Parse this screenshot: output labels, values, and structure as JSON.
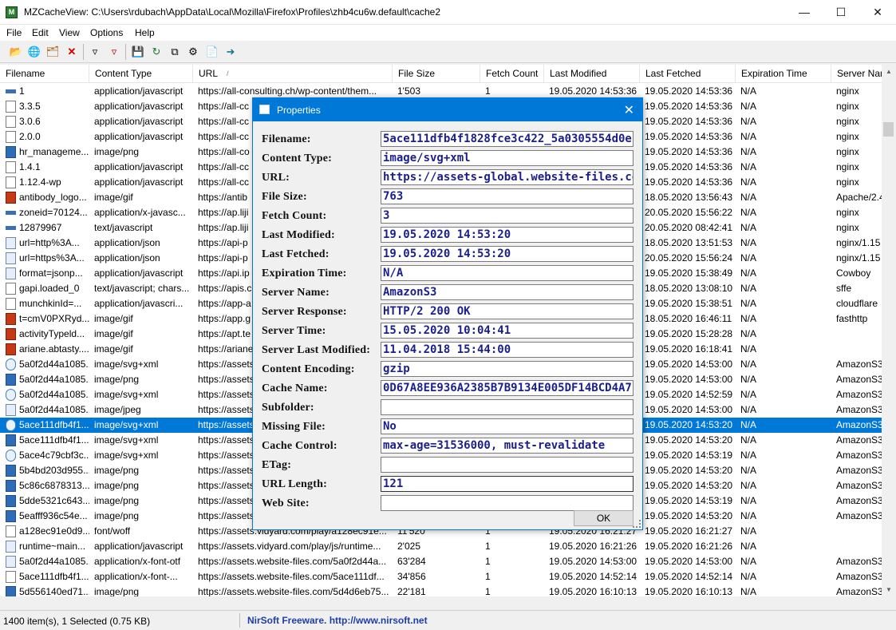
{
  "window": {
    "title": "MZCacheView:  C:\\Users\\rdubach\\AppData\\Local\\Mozilla\\Firefox\\Profiles\\zhb4cu6w.default\\cache2",
    "icon": "mz"
  },
  "menu": [
    "File",
    "Edit",
    "View",
    "Options",
    "Help"
  ],
  "columns": [
    "Filename",
    "Content Type",
    "URL",
    "File Size",
    "Fetch Count",
    "Last Modified",
    "Last Fetched",
    "Expiration Time",
    "Server Nam"
  ],
  "url_sort_marker": "/",
  "rows": [
    {
      "icon": "dash",
      "f": "1",
      "t": "application/javascript",
      "u": "https://all-consulting.ch/wp-content/them...",
      "s": "1'503",
      "c": "1",
      "m": "19.05.2020 14:53:36",
      "l": "19.05.2020 14:53:36",
      "e": "N/A",
      "n": "nginx"
    },
    {
      "icon": "js",
      "f": "3.3.5",
      "t": "application/javascript",
      "u": "https://all-cc",
      "s": "",
      "c": "",
      "m": "",
      "l": "19.05.2020 14:53:36",
      "e": "N/A",
      "n": "nginx"
    },
    {
      "icon": "js",
      "f": "3.0.6",
      "t": "application/javascript",
      "u": "https://all-cc",
      "s": "",
      "c": "",
      "m": "",
      "l": "19.05.2020 14:53:36",
      "e": "N/A",
      "n": "nginx"
    },
    {
      "icon": "js",
      "f": "2.0.0",
      "t": "application/javascript",
      "u": "https://all-cc",
      "s": "",
      "c": "",
      "m": "",
      "l": "19.05.2020 14:53:36",
      "e": "N/A",
      "n": "nginx"
    },
    {
      "icon": "blue",
      "f": "hr_manageme...",
      "t": "image/png",
      "u": "https://all-co",
      "s": "",
      "c": "",
      "m": "",
      "l": "19.05.2020 14:53:36",
      "e": "N/A",
      "n": "nginx"
    },
    {
      "icon": "js",
      "f": "1.4.1",
      "t": "application/javascript",
      "u": "https://all-cc",
      "s": "",
      "c": "",
      "m": "",
      "l": "19.05.2020 14:53:36",
      "e": "N/A",
      "n": "nginx"
    },
    {
      "icon": "js",
      "f": "1.12.4-wp",
      "t": "application/javascript",
      "u": "https://all-cc",
      "s": "",
      "c": "",
      "m": "",
      "l": "19.05.2020 14:53:36",
      "e": "N/A",
      "n": "nginx"
    },
    {
      "icon": "gif",
      "f": "antibody_logo...",
      "t": "image/gif",
      "u": "https://antib",
      "s": "",
      "c": "",
      "m": "",
      "l": "18.05.2020 13:56:43",
      "e": "N/A",
      "n": "Apache/2.4"
    },
    {
      "icon": "dash",
      "f": "zoneid=70124...",
      "t": "application/x-javasc...",
      "u": "https://ap.liji",
      "s": "",
      "c": "",
      "m": "",
      "l": "20.05.2020 15:56:22",
      "e": "N/A",
      "n": "nginx"
    },
    {
      "icon": "dash",
      "f": "12879967",
      "t": "text/javascript",
      "u": "https://ap.liji",
      "s": "",
      "c": "",
      "m": "",
      "l": "20.05.2020 08:42:41",
      "e": "N/A",
      "n": "nginx"
    },
    {
      "icon": "img",
      "f": "url=http%3A...",
      "t": "application/json",
      "u": "https://api-p",
      "s": "",
      "c": "",
      "m": "",
      "l": "18.05.2020 13:51:53",
      "e": "N/A",
      "n": "nginx/1.15"
    },
    {
      "icon": "img",
      "f": "url=https%3A...",
      "t": "application/json",
      "u": "https://api-p",
      "s": "",
      "c": "",
      "m": "",
      "l": "20.05.2020 15:56:24",
      "e": "N/A",
      "n": "nginx/1.15"
    },
    {
      "icon": "img",
      "f": "format=jsonp...",
      "t": "application/javascript",
      "u": "https://api.ip",
      "s": "",
      "c": "",
      "m": "",
      "l": "19.05.2020 15:38:49",
      "e": "N/A",
      "n": "Cowboy"
    },
    {
      "icon": "js",
      "f": "gapi.loaded_0",
      "t": "text/javascript; chars...",
      "u": "https://apis.c",
      "s": "",
      "c": "",
      "m": "",
      "l": "18.05.2020 13:08:10",
      "e": "N/A",
      "n": "sffe"
    },
    {
      "icon": "js",
      "f": "munchkinId=...",
      "t": "application/javascri...",
      "u": "https://app-a",
      "s": "",
      "c": "",
      "m": "",
      "l": "19.05.2020 15:38:51",
      "e": "N/A",
      "n": "cloudflare"
    },
    {
      "icon": "gif",
      "f": "t=cmV0PXRyd...",
      "t": "image/gif",
      "u": "https://app.g",
      "s": "",
      "c": "",
      "m": "",
      "l": "18.05.2020 16:46:11",
      "e": "N/A",
      "n": "fasthttp"
    },
    {
      "icon": "gif",
      "f": "activityTypeld...",
      "t": "image/gif",
      "u": "https://apt.te",
      "s": "",
      "c": "",
      "m": "",
      "l": "19.05.2020 15:28:28",
      "e": "N/A",
      "n": ""
    },
    {
      "icon": "gif",
      "f": "ariane.abtasty....",
      "t": "image/gif",
      "u": "https://ariane",
      "s": "",
      "c": "",
      "m": "",
      "l": "19.05.2020 16:18:41",
      "e": "N/A",
      "n": ""
    },
    {
      "icon": "ie",
      "f": "5a0f2d44a1085...",
      "t": "image/svg+xml",
      "u": "https://assets",
      "s": "",
      "c": "",
      "m": "",
      "l": "19.05.2020 14:53:00",
      "e": "N/A",
      "n": "AmazonS3"
    },
    {
      "icon": "blue",
      "f": "5a0f2d44a1085...",
      "t": "image/png",
      "u": "https://assets",
      "s": "",
      "c": "",
      "m": "",
      "l": "19.05.2020 14:53:00",
      "e": "N/A",
      "n": "AmazonS3"
    },
    {
      "icon": "ie",
      "f": "5a0f2d44a1085...",
      "t": "image/svg+xml",
      "u": "https://assets",
      "s": "",
      "c": "",
      "m": "",
      "l": "19.05.2020 14:52:59",
      "e": "N/A",
      "n": "AmazonS3"
    },
    {
      "icon": "img",
      "f": "5a0f2d44a1085...",
      "t": "image/jpeg",
      "u": "https://assets",
      "s": "",
      "c": "",
      "m": "",
      "l": "19.05.2020 14:53:00",
      "e": "N/A",
      "n": "AmazonS3"
    },
    {
      "icon": "ie",
      "f": "5ace111dfb4f1...",
      "t": "image/svg+xml",
      "u": "https://assets",
      "s": "",
      "c": "",
      "m": "",
      "l": "19.05.2020 14:53:20",
      "e": "N/A",
      "n": "AmazonS3",
      "sel": true
    },
    {
      "icon": "blue",
      "f": "5ace111dfb4f1...",
      "t": "image/svg+xml",
      "u": "https://assets",
      "s": "",
      "c": "",
      "m": "",
      "l": "19.05.2020 14:53:20",
      "e": "N/A",
      "n": "AmazonS3"
    },
    {
      "icon": "ie",
      "f": "5ace4c79cbf3c...",
      "t": "image/svg+xml",
      "u": "https://assets",
      "s": "",
      "c": "",
      "m": "",
      "l": "19.05.2020 14:53:19",
      "e": "N/A",
      "n": "AmazonS3"
    },
    {
      "icon": "blue",
      "f": "5b4bd203d955...",
      "t": "image/png",
      "u": "https://assets",
      "s": "",
      "c": "",
      "m": "",
      "l": "19.05.2020 14:53:20",
      "e": "N/A",
      "n": "AmazonS3"
    },
    {
      "icon": "blue",
      "f": "5c86c6878313...",
      "t": "image/png",
      "u": "https://assets",
      "s": "",
      "c": "",
      "m": "",
      "l": "19.05.2020 14:53:20",
      "e": "N/A",
      "n": "AmazonS3"
    },
    {
      "icon": "blue",
      "f": "5dde5321c643...",
      "t": "image/png",
      "u": "https://assets",
      "s": "",
      "c": "",
      "m": "",
      "l": "19.05.2020 14:53:19",
      "e": "N/A",
      "n": "AmazonS3"
    },
    {
      "icon": "blue",
      "f": "5eafff936c54e...",
      "t": "image/png",
      "u": "https://assets",
      "s": "",
      "c": "",
      "m": "",
      "l": "19.05.2020 14:53:20",
      "e": "N/A",
      "n": "AmazonS3"
    },
    {
      "icon": "js",
      "f": "a128ec91e0d9...",
      "t": "font/woff",
      "u": "https://assets.vidyard.com/play/a128ec91e...",
      "s": "11'520",
      "c": "1",
      "m": "19.05.2020 16:21:27",
      "l": "19.05.2020 16:21:27",
      "e": "N/A",
      "n": ""
    },
    {
      "icon": "img",
      "f": "runtime~main...",
      "t": "application/javascript",
      "u": "https://assets.vidyard.com/play/js/runtime...",
      "s": "2'025",
      "c": "1",
      "m": "19.05.2020 16:21:26",
      "l": "19.05.2020 16:21:26",
      "e": "N/A",
      "n": ""
    },
    {
      "icon": "img",
      "f": "5a0f2d44a1085...",
      "t": "application/x-font-otf",
      "u": "https://assets.website-files.com/5a0f2d44a...",
      "s": "63'284",
      "c": "1",
      "m": "19.05.2020 14:53:00",
      "l": "19.05.2020 14:53:00",
      "e": "N/A",
      "n": "AmazonS3"
    },
    {
      "icon": "js",
      "f": "5ace111dfb4f1...",
      "t": "application/x-font-...",
      "u": "https://assets.website-files.com/5ace111df...",
      "s": "34'856",
      "c": "1",
      "m": "19.05.2020 14:52:14",
      "l": "19.05.2020 14:52:14",
      "e": "N/A",
      "n": "AmazonS3"
    },
    {
      "icon": "blue",
      "f": "5d556140ed71...",
      "t": "image/png",
      "u": "https://assets.website-files.com/5d4d6eb75...",
      "s": "22'181",
      "c": "1",
      "m": "19.05.2020 16:10:13",
      "l": "19.05.2020 16:10:13",
      "e": "N/A",
      "n": "AmazonS3"
    }
  ],
  "dialog": {
    "title": "Properties",
    "fields": [
      {
        "label": "Filename:",
        "value": "5ace111dfb4f1828fce3c422_5a0305554d0ef800("
      },
      {
        "label": "Content Type:",
        "value": "image/svg+xml"
      },
      {
        "label": "URL:",
        "value": "https://assets-global.website-files.com/5ace111c"
      },
      {
        "label": "File Size:",
        "value": "763"
      },
      {
        "label": "Fetch Count:",
        "value": "3"
      },
      {
        "label": "Last Modified:",
        "value": "19.05.2020 14:53:20"
      },
      {
        "label": "Last Fetched:",
        "value": "19.05.2020 14:53:20"
      },
      {
        "label": "Expiration Time:",
        "value": "N/A"
      },
      {
        "label": "Server Name:",
        "value": "AmazonS3"
      },
      {
        "label": "Server Response:",
        "value": "HTTP/2 200 OK"
      },
      {
        "label": "Server Time:",
        "value": "15.05.2020 10:04:41"
      },
      {
        "label": "Server Last Modified:",
        "value": "11.04.2018 15:44:00"
      },
      {
        "label": "Content Encoding:",
        "value": "gzip"
      },
      {
        "label": "Cache Name:",
        "value": "0D67A8EE936A2385B7B9134E005DF14BCD4A7"
      },
      {
        "label": "Subfolder:",
        "value": ""
      },
      {
        "label": "Missing File:",
        "value": "No"
      },
      {
        "label": "Cache Control:",
        "value": "max-age=31536000, must-revalidate"
      },
      {
        "label": "ETag:",
        "value": ""
      },
      {
        "label": "URL Length:",
        "value": "121"
      },
      {
        "label": "Web Site:",
        "value": ""
      }
    ],
    "ok_label": "OK"
  },
  "status": {
    "count": "1400 item(s), 1 Selected  (0.75 KB)",
    "credit": "NirSoft Freeware.  http://www.nirsoft.net"
  }
}
